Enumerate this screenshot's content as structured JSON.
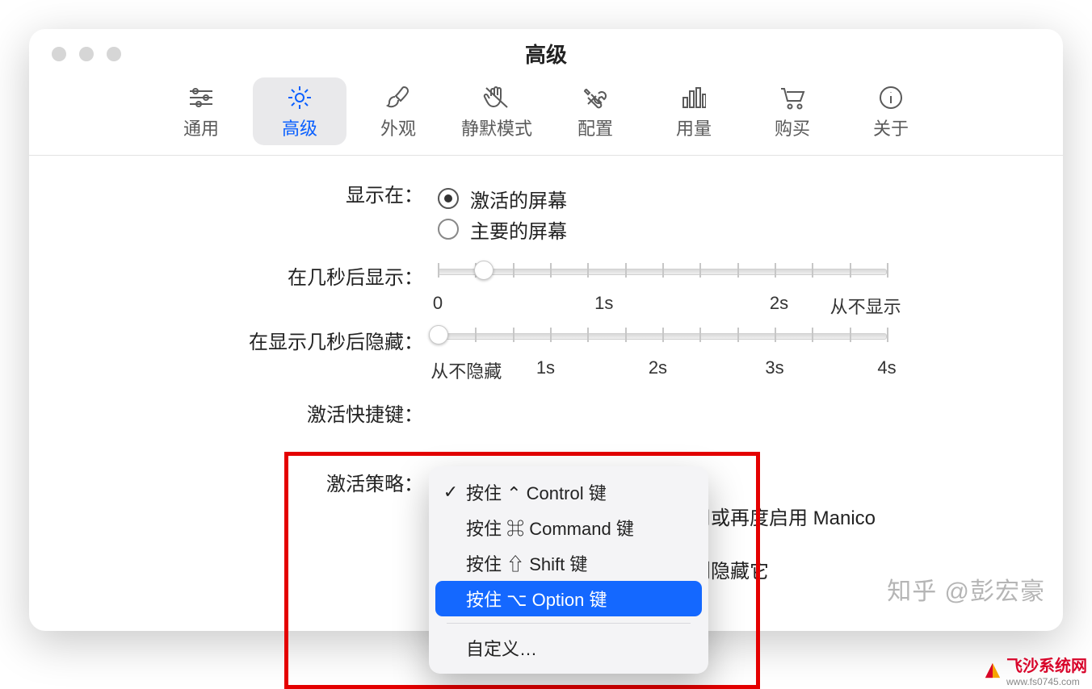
{
  "window": {
    "title": "高级"
  },
  "toolbar": {
    "items": [
      {
        "id": "general",
        "label": "通用"
      },
      {
        "id": "advanced",
        "label": "高级"
      },
      {
        "id": "appearance",
        "label": "外观"
      },
      {
        "id": "silent",
        "label": "静默模式"
      },
      {
        "id": "config",
        "label": "配置"
      },
      {
        "id": "usage",
        "label": "用量"
      },
      {
        "id": "buy",
        "label": "购买"
      },
      {
        "id": "about",
        "label": "关于"
      }
    ],
    "active": "advanced"
  },
  "rows": {
    "display_on": {
      "label": "显示在：",
      "options": [
        "激活的屏幕",
        "主要的屏幕"
      ],
      "selected": 0
    },
    "show_after": {
      "label": "在几秒后显示：",
      "ticks_labels": [
        "0",
        "1s",
        "2s",
        "从不显示"
      ],
      "value_pct": 10
    },
    "hide_after": {
      "label": "在显示几秒后隐藏：",
      "ticks_labels": [
        "从不隐藏",
        "1s",
        "2s",
        "3s",
        "4s"
      ],
      "value_pct": 0
    },
    "hotkey": {
      "label": "激活快捷键："
    },
    "strategy": {
      "label": "激活策略："
    },
    "side_text_1": "用或再度启用 Manico",
    "side_text_2": "则隐藏它"
  },
  "popup": {
    "items": [
      "按住 ⌃ Control 键",
      "按住 ⌘ Command 键",
      "按住 ⇧ Shift 键",
      "按住 ⌥ Option 键"
    ],
    "custom": "自定义…",
    "checked": 0,
    "highlighted": 3
  },
  "watermarks": {
    "zhihu": "知乎 @彭宏豪",
    "site_name": "飞沙系统网",
    "site_url": "www.fs0745.com"
  }
}
